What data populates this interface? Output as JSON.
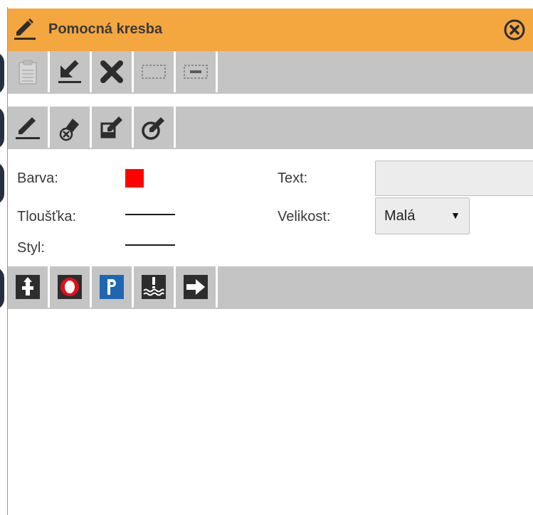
{
  "window": {
    "title": "Pomocná kresba",
    "icon": "pencil-icon",
    "close_icon": "close-circle-icon",
    "accent_color": "#f4a63f"
  },
  "toolbar_1": {
    "buttons": [
      {
        "name": "paste-icon",
        "enabled": false
      },
      {
        "name": "import-arrow-icon",
        "enabled": true
      },
      {
        "name": "delete-x-icon",
        "enabled": true
      },
      {
        "name": "select-rectangle-icon",
        "enabled": false
      },
      {
        "name": "deselect-rectangle-icon",
        "enabled": false
      }
    ]
  },
  "toolbar_2": {
    "buttons": [
      {
        "name": "draw-pencil-icon"
      },
      {
        "name": "erase-point-icon"
      },
      {
        "name": "fill-polygon-icon"
      },
      {
        "name": "draw-circle-icon"
      }
    ]
  },
  "properties": {
    "color_label": "Barva:",
    "color_value": "#ff0000",
    "thickness_label": "Tloušťka:",
    "style_label": "Styl:",
    "text_label": "Text:",
    "text_value": "",
    "size_label": "Velikost:",
    "size_value": "Malá",
    "size_arrow": "▼"
  },
  "toolbar_4": {
    "buttons": [
      {
        "name": "hydrant-icon"
      },
      {
        "name": "no-entry-sign-icon"
      },
      {
        "name": "parking-sign-icon"
      },
      {
        "name": "water-source-icon"
      },
      {
        "name": "arrow-right-icon"
      }
    ]
  }
}
